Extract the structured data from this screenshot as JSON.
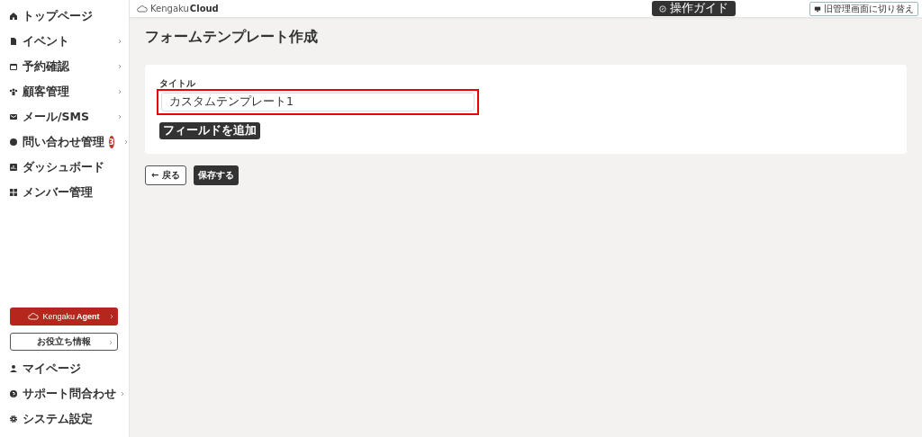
{
  "sidebar": {
    "items": [
      {
        "label": "トップページ",
        "expandable": false
      },
      {
        "label": "イベント",
        "expandable": true
      },
      {
        "label": "予約確認",
        "expandable": true
      },
      {
        "label": "顧客管理",
        "expandable": true
      },
      {
        "label": "メール/SMS",
        "expandable": true
      },
      {
        "label": "問い合わせ管理",
        "expandable": true,
        "badge": "3"
      },
      {
        "label": "ダッシュボード",
        "expandable": false
      },
      {
        "label": "メンバー管理",
        "expandable": false
      }
    ],
    "agent_button": {
      "brand": "Kengaku",
      "product": "Agent"
    },
    "info_button": "お役立ち情報",
    "bottom_items": [
      {
        "label": "マイページ",
        "expandable": false
      },
      {
        "label": "サポート問合わせ",
        "expandable": true
      },
      {
        "label": "システム設定",
        "expandable": false
      }
    ]
  },
  "header": {
    "logo": {
      "brand": "Kengaku",
      "product": "Cloud"
    },
    "guide_button": "操作ガイド",
    "switch_button": "旧管理画面に切り替え"
  },
  "page_title": "フォームテンプレート作成",
  "form": {
    "title_label": "タイトル",
    "title_value": "カスタムテンプレート1",
    "highlighted": true,
    "add_field_button": "フィールドを追加"
  },
  "actions": {
    "back_button": "← 戻る",
    "save_button": "保存する"
  }
}
